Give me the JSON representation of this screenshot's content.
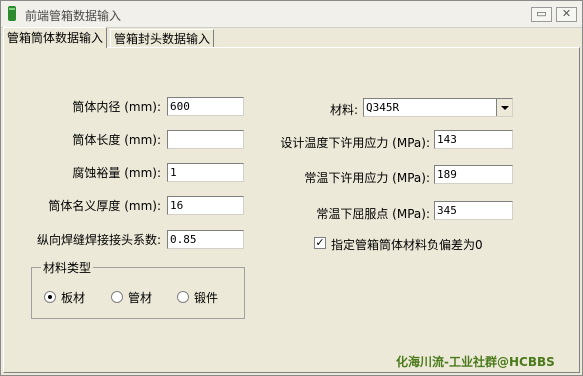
{
  "window": {
    "title": "前端管箱数据输入",
    "minimize_glyph": "▭",
    "close_glyph": "✕"
  },
  "tabs": [
    {
      "label": "管箱筒体数据输入",
      "active": true
    },
    {
      "label": "管箱封头数据输入",
      "active": false
    }
  ],
  "left_fields": [
    {
      "label": "筒体内径 (mm):",
      "value": "600"
    },
    {
      "label": "筒体长度 (mm):",
      "value": ""
    },
    {
      "label": "腐蚀裕量 (mm):",
      "value": "1"
    },
    {
      "label": "筒体名义厚度 (mm):",
      "value": "16"
    },
    {
      "label": "纵向焊缝焊接接头系数:",
      "value": "0.85"
    }
  ],
  "material": {
    "label": "材料:",
    "value": "Q345R"
  },
  "right_fields": [
    {
      "label": "设计温度下许用应力 (MPa):",
      "value": "143"
    },
    {
      "label": "常温下许用应力 (MPa):",
      "value": "189"
    },
    {
      "label": "常温下屈服点 (MPa):",
      "value": "345"
    }
  ],
  "checkbox": {
    "label": "指定管箱筒体材料负偏差为0",
    "checked": true,
    "glyph": "✓"
  },
  "material_type": {
    "title": "材料类型",
    "options": [
      {
        "label": "板材",
        "checked": true
      },
      {
        "label": "管材",
        "checked": false
      },
      {
        "label": "锻件",
        "checked": false
      }
    ]
  },
  "watermark": "化海川流-工业社群@HCBBS",
  "colors": {
    "face": "#ece9d8",
    "watermark": "#4a7a1a",
    "icon": "#2d8a2d"
  }
}
